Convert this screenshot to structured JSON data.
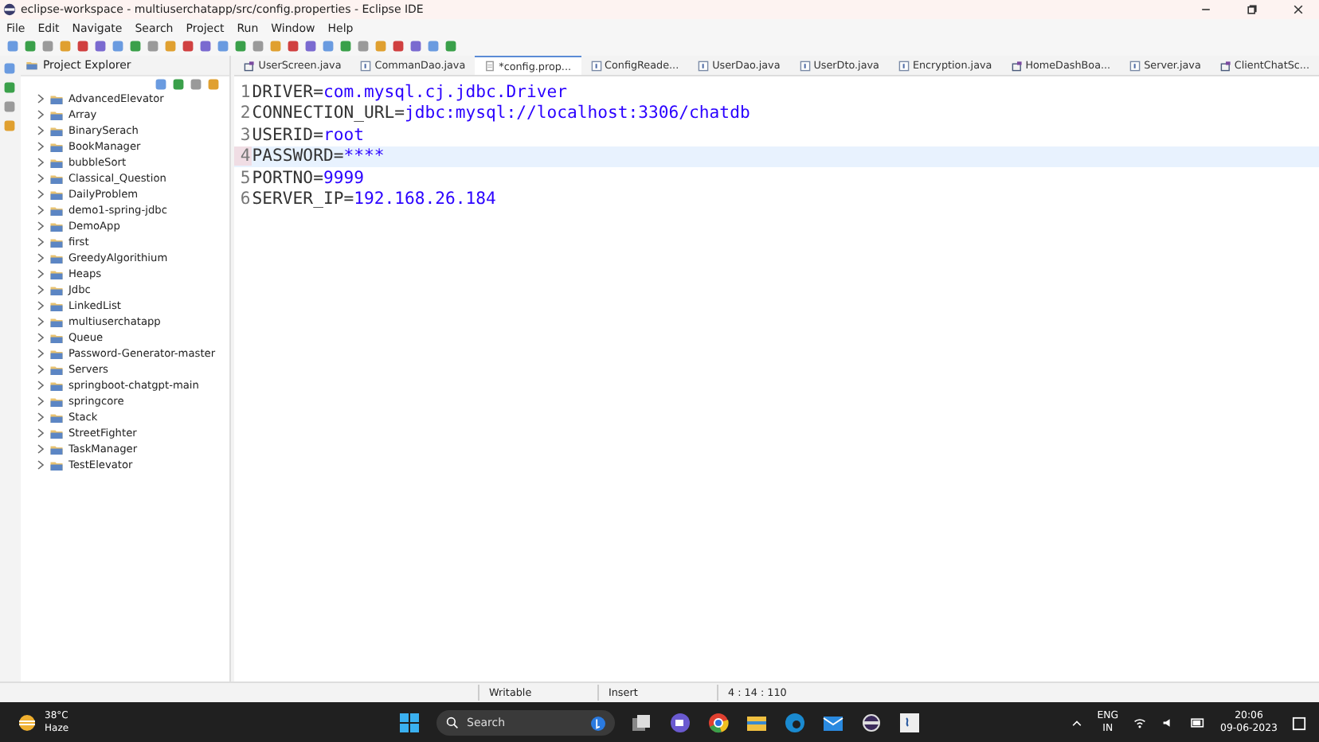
{
  "window": {
    "title": "eclipse-workspace - multiuserchatapp/src/config.properties - Eclipse IDE"
  },
  "menu": [
    "File",
    "Edit",
    "Navigate",
    "Search",
    "Project",
    "Run",
    "Window",
    "Help"
  ],
  "explorer": {
    "title": "Project Explorer",
    "projects": [
      {
        "label": "AdvancedElevator"
      },
      {
        "label": "Array"
      },
      {
        "label": "BinarySerach"
      },
      {
        "label": "BookManager"
      },
      {
        "label": "bubbleSort"
      },
      {
        "label": "Classical_Question"
      },
      {
        "label": "DailyProblem"
      },
      {
        "label": "demo1-spring-jdbc"
      },
      {
        "label": "DemoApp"
      },
      {
        "label": "first"
      },
      {
        "label": "GreedyAlgorithium"
      },
      {
        "label": "Heaps"
      },
      {
        "label": "Jdbc"
      },
      {
        "label": "LinkedList"
      },
      {
        "label": "multiuserchatapp"
      },
      {
        "label": "Queue"
      },
      {
        "label": "Password-Generator-master"
      },
      {
        "label": "Servers"
      },
      {
        "label": "springboot-chatgpt-main"
      },
      {
        "label": "springcore"
      },
      {
        "label": "Stack"
      },
      {
        "label": "StreetFighter"
      },
      {
        "label": "TaskManager"
      },
      {
        "label": "TestElevator"
      }
    ]
  },
  "tabs": [
    {
      "label": "UserScreen.java",
      "kind": "window",
      "selected": false
    },
    {
      "label": "CommanDao.java",
      "kind": "java",
      "selected": false
    },
    {
      "label": "*config.prop...",
      "kind": "file",
      "selected": true
    },
    {
      "label": "ConfigReade...",
      "kind": "java",
      "selected": false
    },
    {
      "label": "UserDao.java",
      "kind": "java",
      "selected": false
    },
    {
      "label": "UserDto.java",
      "kind": "java",
      "selected": false
    },
    {
      "label": "Encryption.java",
      "kind": "java",
      "selected": false
    },
    {
      "label": "HomeDashBoa...",
      "kind": "window",
      "selected": false
    },
    {
      "label": "Server.java",
      "kind": "java",
      "selected": false
    },
    {
      "label": "ClientChatSc...",
      "kind": "window",
      "selected": false
    }
  ],
  "editor": {
    "lines": [
      {
        "number": "1",
        "key": "DRIVER=",
        "value": "com.mysql.cj.jdbc.Driver",
        "current": false
      },
      {
        "number": "2",
        "key": "CONNECTION_URL=",
        "value": "jdbc:mysql://localhost:3306/chatdb",
        "current": false
      },
      {
        "number": "3",
        "key": "USERID=",
        "value": "root",
        "current": false
      },
      {
        "number": "4",
        "key": "PASSWORD=",
        "value": "****",
        "current": true
      },
      {
        "number": "5",
        "key": "PORTNO=",
        "value": "9999",
        "current": false
      },
      {
        "number": "6",
        "key": "SERVER_IP=",
        "value": "192.168.26.184",
        "current": false
      }
    ]
  },
  "status_bar": [
    "Writable",
    "Insert",
    "4 : 14 : 110"
  ],
  "taskbar": {
    "temperature": "38°C",
    "weather": "Haze",
    "search": {
      "placeholder": "Search"
    },
    "language": "ENG",
    "region": "IN",
    "time": "20:06",
    "date": "09-06-2023"
  }
}
